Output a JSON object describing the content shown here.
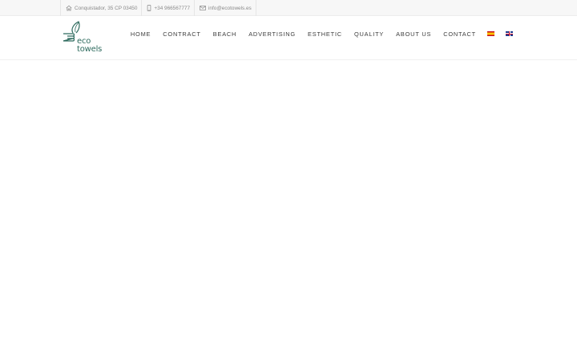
{
  "topbar": {
    "address": "Conquistador, 35 CP 03450",
    "phone": "+34 966567777",
    "email": "info@ecotowels.es",
    "icons": [
      "home-icon",
      "mobile-phone-icon",
      "envelope-icon"
    ]
  },
  "logo": {
    "line1": "eco",
    "line2": "towels",
    "color": "#2e6b5e"
  },
  "nav": {
    "items": [
      {
        "label": "HOME"
      },
      {
        "label": "CONTRACT"
      },
      {
        "label": "BEACH"
      },
      {
        "label": "ADVERTISING"
      },
      {
        "label": "ESTHETIC"
      },
      {
        "label": "QUALITY"
      },
      {
        "label": "ABOUT US"
      },
      {
        "label": "CONTACT"
      }
    ],
    "languages": [
      "spanish-flag-icon",
      "english-flag-icon"
    ]
  }
}
